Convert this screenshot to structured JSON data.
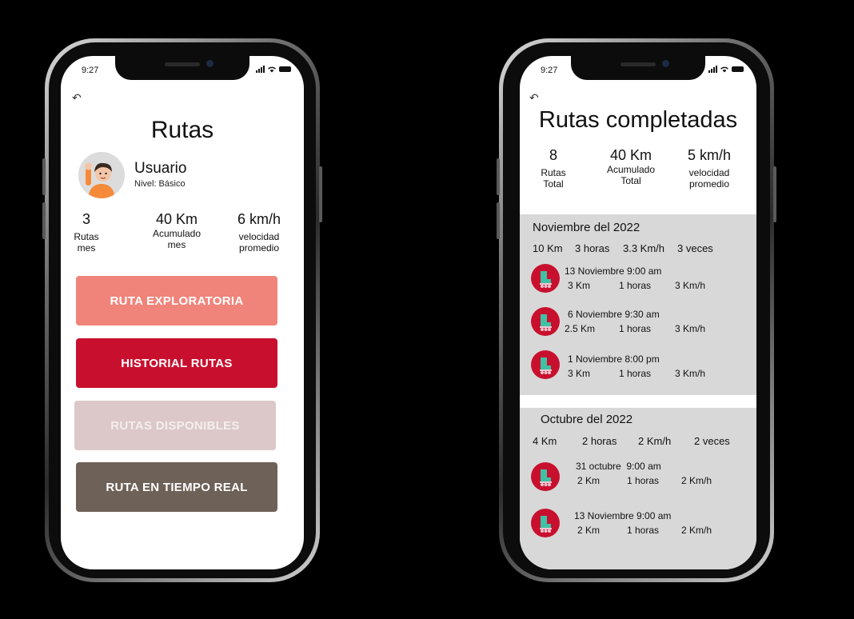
{
  "status": {
    "time": "9:27"
  },
  "left": {
    "title": "Rutas",
    "user": {
      "name": "Usuario",
      "level": "Nivel: Básico"
    },
    "stats": [
      {
        "value": "3",
        "label1": "Rutas",
        "label2": "mes"
      },
      {
        "value": "40 Km",
        "label1": "Acumulado",
        "label2": "mes"
      },
      {
        "value": "6 km/h",
        "label1": "velocidad",
        "label2": "promedio"
      }
    ],
    "buttons": [
      {
        "label": "RUTA EXPLORATORIA",
        "color": "#f0847a"
      },
      {
        "label": "HISTORIAL RUTAS",
        "color": "#c8102e"
      },
      {
        "label": "RUTAS DISPONIBLES",
        "color": "#dcc8c8"
      },
      {
        "label": "RUTA EN TIEMPO REAL",
        "color": "#6e6158"
      }
    ]
  },
  "right": {
    "title": "Rutas completadas",
    "stats": [
      {
        "value": "8",
        "label1": "Rutas",
        "label2": "Total"
      },
      {
        "value": "40 Km",
        "label1": "Acumulado",
        "label2": "Total"
      },
      {
        "value": "5 km/h",
        "label1": "velocidad",
        "label2": "promedio"
      }
    ],
    "months": [
      {
        "title": "Noviembre del 2022",
        "summary": {
          "km": "10 Km",
          "hours": "3 horas",
          "speed": "3.3 Km/h",
          "times": "3 veces"
        },
        "routes": [
          {
            "date": "13 Noviembre 9:00 am",
            "km": "3 Km",
            "hours": "1 horas",
            "speed": "3 Km/h"
          },
          {
            "date": "6 Noviembre 9:30 am",
            "km": "2.5 Km",
            "hours": "1 horas",
            "speed": "3 Km/h"
          },
          {
            "date": "1 Noviembre 8:00 pm",
            "km": "3 Km",
            "hours": "1 horas",
            "speed": "3 Km/h"
          }
        ]
      },
      {
        "title": "Octubre del 2022",
        "summary": {
          "km": "4 Km",
          "hours": "2 horas",
          "speed": "2 Km/h",
          "times": "2 veces"
        },
        "routes": [
          {
            "date": "31 octubre  9:00 am",
            "km": "2 Km",
            "hours": "1 horas",
            "speed": "2 Km/h"
          },
          {
            "date": "13 Noviembre 9:00 am",
            "km": "2 Km",
            "hours": "1 horas",
            "speed": "2 Km/h"
          }
        ]
      }
    ]
  },
  "colors": {
    "accent": "#c8102e",
    "section_bg": "#d8d8d8"
  },
  "icons": {
    "back": "back-arrow-icon",
    "route": "roller-skate-icon",
    "avatar": "user-avatar-icon"
  }
}
